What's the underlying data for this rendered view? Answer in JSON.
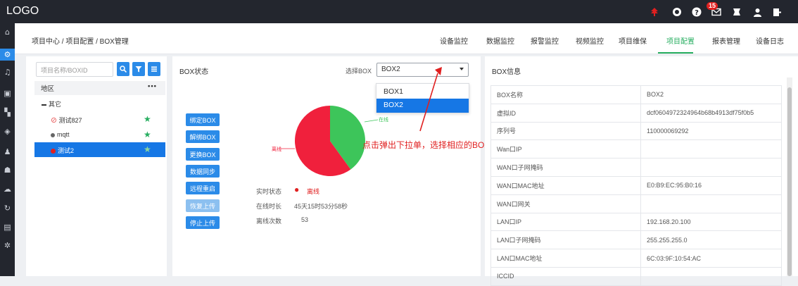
{
  "app": {
    "logo": "LOGO"
  },
  "topbar": {
    "icons": [
      "tree-icon",
      "clock-icon",
      "help-icon",
      "mail-icon",
      "fullscreen-icon",
      "user-icon",
      "logout-icon"
    ],
    "mail_badge": "15"
  },
  "sidebar": {
    "icons": [
      "home-icon",
      "settings-icon",
      "alarm-icon",
      "monitor-icon",
      "dashboard-icon",
      "stack-icon",
      "user-icon",
      "team-icon",
      "cloud-icon",
      "refresh-icon",
      "document-icon",
      "gear-icon"
    ]
  },
  "breadcrumb": "项目中心 / 项目配置 / BOX管理",
  "nav": {
    "tabs": [
      "设备监控",
      "数据监控",
      "报警监控",
      "视频监控",
      "项目维保",
      "项目配置",
      "报表管理",
      "设备日志"
    ],
    "active": "项目配置"
  },
  "left": {
    "search_placeholder": "项目名称/BOXID",
    "area_label": "地区",
    "more": "•••",
    "group": "其它",
    "items": [
      {
        "name": "测试827",
        "status": "disconnected"
      },
      {
        "name": "mqtt",
        "status": "offline"
      },
      {
        "name": "测试2",
        "status": "alarm"
      }
    ]
  },
  "middle": {
    "title": "BOX状态",
    "select_label": "选择BOX",
    "select_value": "BOX2",
    "options": [
      "BOX1",
      "BOX2"
    ],
    "buttons": [
      "绑定BOX",
      "解绑BOX",
      "更换BOX",
      "数据同步",
      "远程重启",
      "恢复上传",
      "停止上传"
    ],
    "chart_data": {
      "type": "pie",
      "series": [
        {
          "label": "离线",
          "value": 60,
          "color": "#f0203c"
        },
        {
          "label": "在线",
          "value": 40,
          "color": "#3dc55a"
        }
      ]
    },
    "status_label": "实时状态",
    "status_value": "离线",
    "online_label": "在线时长",
    "online_value": "45天15时53分58秒",
    "offline_count_label": "离线次数",
    "offline_count_value": "53",
    "annotation": "点击弹出下拉单，选择相应的BOX"
  },
  "right": {
    "title": "BOX信息",
    "rows": [
      {
        "k": "BOX名称",
        "v": "BOX2"
      },
      {
        "k": "虚拟ID",
        "v": "dcf0604972324964b68b4913df75f0b5"
      },
      {
        "k": "序列号",
        "v": "110000069292"
      },
      {
        "k": "Wan口IP",
        "v": ""
      },
      {
        "k": "WAN口子网掩码",
        "v": ""
      },
      {
        "k": "WAN口MAC地址",
        "v": "E0:B9:EC:95:B0:16"
      },
      {
        "k": "WAN口网关",
        "v": ""
      },
      {
        "k": "LAN口IP",
        "v": "192.168.20.100"
      },
      {
        "k": "LAN口子网掩码",
        "v": "255.255.255.0"
      },
      {
        "k": "LAN口MAC地址",
        "v": "6C:03:9F:10:54:AC"
      },
      {
        "k": "ICCID",
        "v": ""
      }
    ]
  }
}
